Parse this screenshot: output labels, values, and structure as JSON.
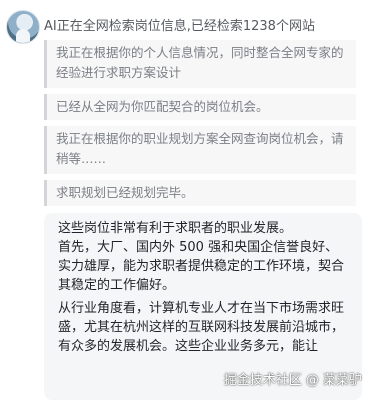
{
  "header": {
    "title": "AI正在全网检索岗位信息,已经检索1238个网站"
  },
  "steps": [
    {
      "text": "我正在根据你的个人信息情况，同时整合全网专家的经验进行求职方案设计"
    },
    {
      "text": "已经从全网为你匹配契合的岗位机会。"
    },
    {
      "text": "我正在根据你的职业规划方案全网查询岗位机会，请稍等……"
    },
    {
      "text": "求职规划已经规划完毕。"
    }
  ],
  "answer": {
    "paragraph_1": "这些岗位非常有利于求职者的职业发展。\n首先，大厂、国内外 500 强和央国企信誉良好、实力雄厚，能为求职者提供稳定的工作环境，契合其稳定的工作偏好。",
    "paragraph_2": "从行业角度看，计算机专业人才在当下市场需求旺盛，尤其在杭州这样的互联网科技发展前沿城市，有众多的发展机会。这些企业业务多元，能让"
  },
  "watermark": {
    "text": "掘金技术社区 @ 菜菜驴"
  }
}
